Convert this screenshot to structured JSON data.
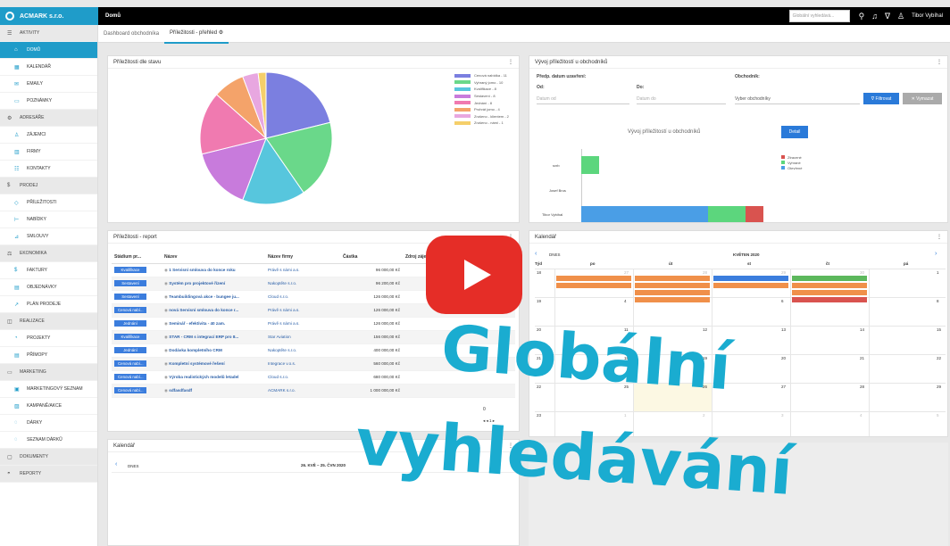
{
  "brand": {
    "name": "ACMARK s.r.o."
  },
  "topbar": {
    "breadcrumb": "Domů",
    "search_placeholder": "Globální vyhledává...",
    "user": "Tibor Vybíhal"
  },
  "tabs": [
    "Dashboard obchodníka",
    "Příležitosti - přehled ⚙"
  ],
  "sidebar": [
    {
      "label": "AKTIVITY",
      "type": "sec",
      "icon": "☰"
    },
    {
      "label": "DOMŮ",
      "type": "act",
      "icon": "⌂"
    },
    {
      "label": "KALENDÁŘ",
      "type": "item",
      "icon": "▦"
    },
    {
      "label": "EMAILY",
      "type": "item",
      "icon": "✉"
    },
    {
      "label": "POZNÁMKY",
      "type": "item",
      "icon": "▭"
    },
    {
      "label": "ADRESÁŘE",
      "type": "sec",
      "icon": "⚙"
    },
    {
      "label": "ZÁJEMCI",
      "type": "item",
      "icon": "♙"
    },
    {
      "label": "FIRMY",
      "type": "item",
      "icon": "▥"
    },
    {
      "label": "KONTAKTY",
      "type": "item",
      "icon": "☷"
    },
    {
      "label": "PRODEJ",
      "type": "sec",
      "icon": "$"
    },
    {
      "label": "PŘÍLEŽITOSTI",
      "type": "item",
      "icon": "◇"
    },
    {
      "label": "NABÍDKY",
      "type": "item",
      "icon": "⊢"
    },
    {
      "label": "SMLOUVY",
      "type": "item",
      "icon": "⊿"
    },
    {
      "label": "EKONOMIKA",
      "type": "sec",
      "icon": "⚖"
    },
    {
      "label": "FAKTURY",
      "type": "item",
      "icon": "$"
    },
    {
      "label": "OBJEDNÁVKY",
      "type": "item",
      "icon": "▤"
    },
    {
      "label": "PLÁN PRODEJE",
      "type": "item",
      "icon": "↗"
    },
    {
      "label": "REALIZACE",
      "type": "sec",
      "icon": "◫"
    },
    {
      "label": "PROJEKTY",
      "type": "item",
      "icon": "◔"
    },
    {
      "label": "PŘÍMOPY",
      "type": "item",
      "icon": "▤"
    },
    {
      "label": "MARKETING",
      "type": "sec",
      "icon": "▭"
    },
    {
      "label": "MARKETINGOVÝ SEZNAM",
      "type": "item",
      "icon": "▣"
    },
    {
      "label": "KAMPANĚ/AKCE",
      "type": "item",
      "icon": "▨"
    },
    {
      "label": "DÁRKY",
      "type": "item",
      "icon": "◌"
    },
    {
      "label": "SEZNAM DÁRKŮ",
      "type": "item",
      "icon": "◌"
    },
    {
      "label": "DOKUMENTY",
      "type": "sec",
      "icon": "▢"
    },
    {
      "label": "REPORTY",
      "type": "sec",
      "icon": "◓"
    }
  ],
  "pie_panel": {
    "title": "Příležitosti dle stavu",
    "legend": [
      {
        "label": "Cenová nabídka - 11",
        "color": "#7b7fe0",
        "value": 11
      },
      {
        "label": "Vyhraný jomo - 10",
        "color": "#6ad88a",
        "value": 10
      },
      {
        "label": "Kvalifikace - 8",
        "color": "#57c6dd",
        "value": 8
      },
      {
        "label": "Sestavení - 8",
        "color": "#c87bdc",
        "value": 8
      },
      {
        "label": "Jednání - 8",
        "color": "#f07ab0",
        "value": 8
      },
      {
        "label": "Prohrát jomo - 4",
        "color": "#f4a36a",
        "value": 4
      },
      {
        "label": "Zrušeno - klientem - 2",
        "color": "#e8a7e0",
        "value": 2
      },
      {
        "label": "Zrušeno - námi - 1",
        "color": "#f5cf6a",
        "value": 1
      }
    ]
  },
  "dev_panel": {
    "title": "Vývoj příležitostí u obchodníků",
    "date_label": "Předp. datum uzavření:",
    "from_label": "Od:",
    "to_label": "Do:",
    "from_ph": "Datum od",
    "to_ph": "Datum do",
    "dealer_label": "Obchodník:",
    "dealer_value": "Vyber obchodníky",
    "filter_btn": "Filtrovat",
    "clear_btn": "Vymazat",
    "chart_title": "Vývoj příležitostí u obchodníků",
    "detail_btn": "Detail",
    "legend": [
      {
        "label": "Ztracené",
        "color": "#d9534f"
      },
      {
        "label": "Vyhrané",
        "color": "#5cd67d"
      },
      {
        "label": "Otevřené",
        "color": "#4a9ee6"
      }
    ],
    "rows": [
      {
        "name": "svrb"
      },
      {
        "name": "Josef Brus"
      },
      {
        "name": "Tibor Vybíhal"
      }
    ]
  },
  "report": {
    "title": "Příležitosti - report",
    "headers": [
      "Stádium pr...",
      "Název",
      "Název firmy",
      "Částka",
      "Zdroj zájemce"
    ],
    "rows": [
      {
        "stage": "Kvalifikace",
        "name": "1 Servisní smlouva do konce roku",
        "firm": "Právě s námi a.s.",
        "amount": "96 000,00 Kč"
      },
      {
        "stage": "Sestavení",
        "name": "Systém pro projektové řízení",
        "firm": "Nakoptěte s.r.o.",
        "amount": "96 200,00 Kč"
      },
      {
        "stage": "Sestavení",
        "name": "Teambuildingová akce - bungee ju...",
        "firm": "Cloud s.r.o.",
        "amount": "126 000,00 Kč"
      },
      {
        "stage": "Cenová nabí...",
        "name": "nová Servisní smlouva do konce r...",
        "firm": "Právě s námi a.s.",
        "amount": "126 000,00 Kč"
      },
      {
        "stage": "Jednání",
        "name": "Seminář - efektivita - 40 zam.",
        "firm": "Právě s námi a.s.",
        "amount": "126 000,00 Kč"
      },
      {
        "stage": "Kvalifikace",
        "name": "STAR - CRM s integrací ERP pro 8...",
        "firm": "Star Aviation",
        "amount": "156 000,00 Kč"
      },
      {
        "stage": "Jednání",
        "name": "Dodávka kompletního CRM",
        "firm": "Nakoptěte s.r.o.",
        "amount": "400 000,00 Kč"
      },
      {
        "stage": "Cenová nabí...",
        "name": "Kompletní systémové řešení",
        "firm": "Integrace v.o.s.",
        "amount": "560 000,00 Kč"
      },
      {
        "stage": "Cenová nabí...",
        "name": "Výroba realistických modelů letadel",
        "firm": "Cloud s.r.o.",
        "amount": "680 000,00 Kč"
      },
      {
        "stage": "Cenová nabí...",
        "name": "sdfasdfasdf",
        "firm": "ACMARK s.r.o.",
        "amount": "1 000 000,00 Kč"
      }
    ],
    "pager": "◂ ◂ 1 ▸",
    "last_num": "0"
  },
  "calendar": {
    "title": "Kalendář",
    "today": "DNES",
    "month": "KVĚTEN 2020",
    "days": [
      "Týd",
      "po",
      "út",
      "st",
      "čt",
      "pá"
    ],
    "weeks": [
      "18",
      "19",
      "20",
      "21",
      "22",
      "23"
    ],
    "nums": [
      [
        "27",
        "28",
        "29",
        "30",
        "1"
      ],
      [
        "4",
        "5",
        "6",
        "7",
        "8"
      ],
      [
        "11",
        "12",
        "13",
        "14",
        "15"
      ],
      [
        "18",
        "19",
        "20",
        "21",
        "22"
      ],
      [
        "25",
        "26",
        "27",
        "28",
        "29"
      ],
      [
        "1",
        "2",
        "3",
        "4",
        "5"
      ]
    ]
  },
  "calendar2": {
    "title": "Kalendář",
    "today": "DNES",
    "range": "26. KVĚ – 25. ČVN 2020"
  },
  "overlay": {
    "line1": "Globální",
    "line2": "vyhledávání"
  }
}
